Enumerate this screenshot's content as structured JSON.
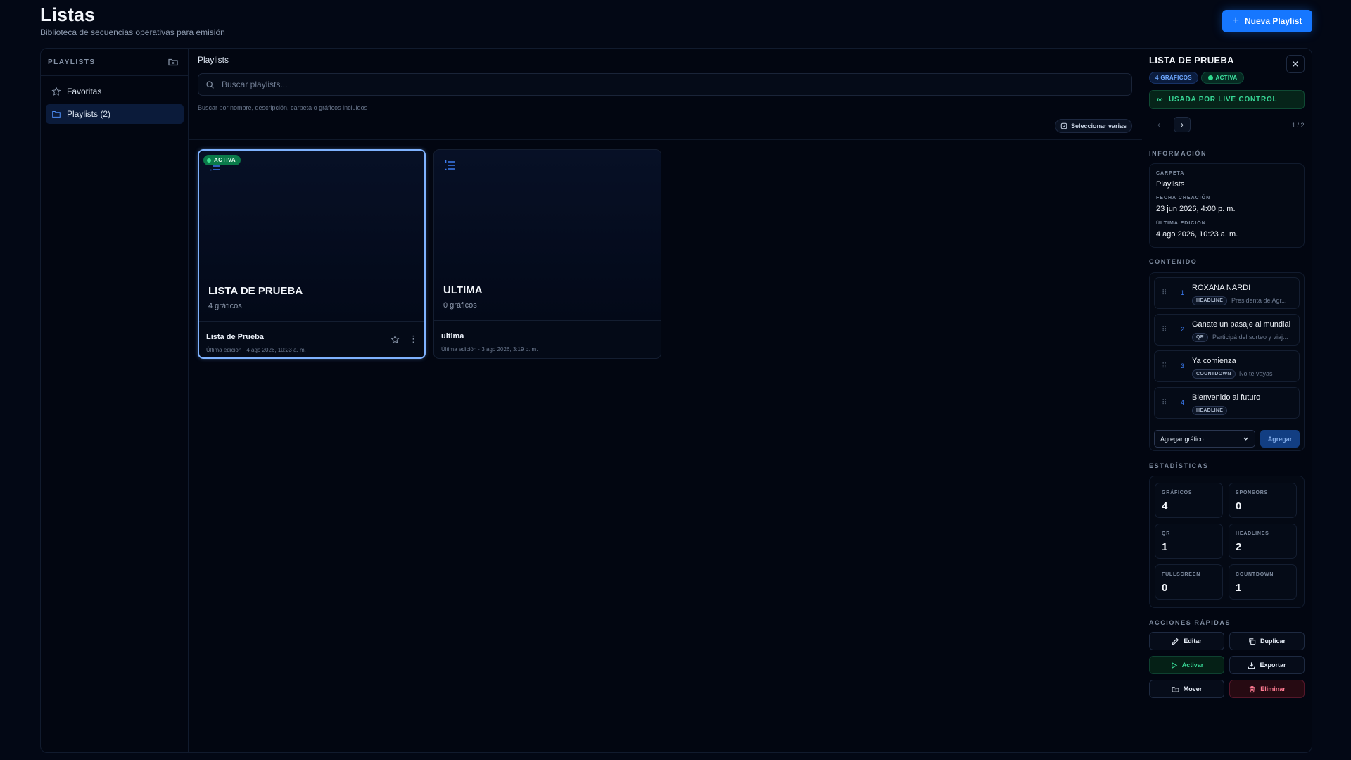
{
  "header": {
    "title": "Listas",
    "subtitle": "Biblioteca de secuencias operativas para emisión",
    "new_button": "Nueva Playlist"
  },
  "sidebar": {
    "title": "PLAYLISTS",
    "items": [
      {
        "label": "Favoritas",
        "icon": "star-icon",
        "active": false
      },
      {
        "label": "Playlists (2)",
        "icon": "folder-icon",
        "active": true
      }
    ]
  },
  "content": {
    "label": "Playlists",
    "search_placeholder": "Buscar playlists...",
    "search_value": "",
    "search_hint": "Buscar por nombre, descripción, carpeta o gráficos incluidos",
    "select_multi": "Seleccionar varias"
  },
  "cards": [
    {
      "badge": "ACTIVA",
      "title": "LISTA DE PRUEBA",
      "count": "4 gráficos",
      "name": "Lista de Prueba",
      "meta": "Última edición · 4 ago 2026, 10:23 a. m.",
      "selected": true
    },
    {
      "badge": "",
      "title": "ULTIMA",
      "count": "0 gráficos",
      "name": "ultima",
      "meta": "Última edición · 3 ago 2026, 3:19 p. m.",
      "selected": false
    }
  ],
  "panel": {
    "title": "LISTA DE PRUEBA",
    "count_badge": "4 GRÁFICOS",
    "active_badge": "ACTIVA",
    "live_bar": "USADA POR LIVE CONTROL",
    "pagination": "1 / 2",
    "info_heading": "INFORMACIÓN",
    "info": [
      {
        "key": "CARPETA",
        "value": "Playlists"
      },
      {
        "key": "FECHA CREACIÓN",
        "value": "23 jun 2026, 4:00 p. m."
      },
      {
        "key": "ÚLTIMA EDICIÓN",
        "value": "4 ago 2026, 10:23 a. m."
      }
    ],
    "content_heading": "CONTENIDO",
    "items": [
      {
        "num": "1",
        "title": "ROXANA NARDI",
        "tag": "HEADLINE",
        "sub": "Presidenta de Agr..."
      },
      {
        "num": "2",
        "title": "Ganate un pasaje al mundial",
        "tag": "QR",
        "sub": "Participá del sorteo y viaj..."
      },
      {
        "num": "3",
        "title": "Ya comienza",
        "tag": "COUNTDOWN",
        "sub": "No te vayas"
      },
      {
        "num": "4",
        "title": "Bienvenido al futuro",
        "tag": "HEADLINE",
        "sub": ""
      }
    ],
    "add_select": "Agregar gráfico...",
    "add_button": "Agregar",
    "stats_heading": "ESTADÍSTICAS",
    "stats": [
      {
        "key": "GRÁFICOS",
        "value": "4"
      },
      {
        "key": "SPONSORS",
        "value": "0"
      },
      {
        "key": "QR",
        "value": "1"
      },
      {
        "key": "HEADLINES",
        "value": "2"
      },
      {
        "key": "FULLSCREEN",
        "value": "0"
      },
      {
        "key": "COUNTDOWN",
        "value": "1"
      }
    ],
    "actions_heading": "ACCIONES RÁPIDAS",
    "actions": {
      "edit": "Editar",
      "duplicate": "Duplicar",
      "activate": "Activar",
      "export": "Exportar",
      "move": "Mover",
      "delete": "Eliminar"
    }
  },
  "colors": {
    "accent": "#1677ff",
    "active_green": "#2fd98d",
    "danger": "#ff7b92",
    "background": "#030815"
  }
}
